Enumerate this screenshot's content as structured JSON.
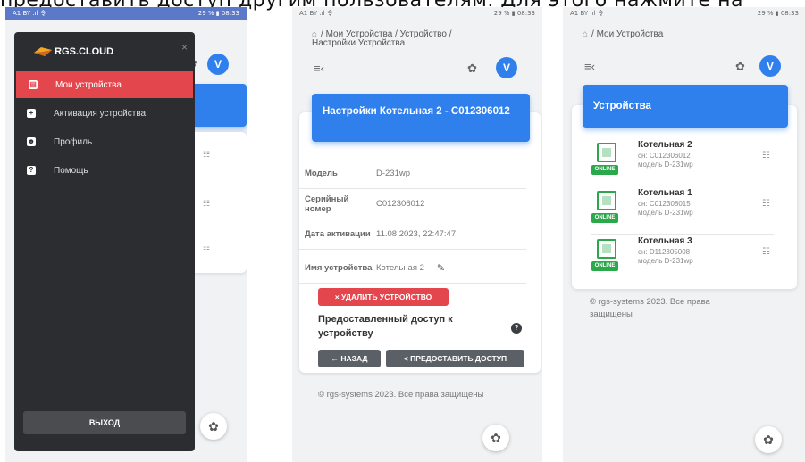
{
  "caption": "предоставить доступ другим пользователям. Для этого нажмите на",
  "status": {
    "left": "A1 BY .ıl 令 ",
    "right": "29 % ▮ 08:33"
  },
  "phone1": {
    "brand": "RGS.CLOUD",
    "menu": [
      {
        "label": "Мои устройства",
        "icon": "devices-icon"
      },
      {
        "label": "Активация устройства",
        "icon": "plus-icon"
      },
      {
        "label": "Профиль",
        "icon": "profile-icon"
      },
      {
        "label": "Помощь",
        "icon": "help-icon"
      }
    ],
    "logout": "ВЫХОД",
    "avatar": "V"
  },
  "phone2": {
    "breadcrumb": "/ Мои Устройства / Устройство /",
    "breadcrumb2": "Настройки Устройства",
    "avatar": "V",
    "title": "Настройки Котельная 2 - C012306012",
    "rows": [
      {
        "key": "Модель",
        "value": "D-231wp"
      },
      {
        "key": "Серийный номер",
        "value": "C012306012"
      },
      {
        "key": "Дата активации",
        "value": "11.08.2023, 22:47:47"
      },
      {
        "key": "Имя устройства",
        "value": "Котельная 2"
      }
    ],
    "delete_button": "× УДАЛИТЬ УСТРОЙСТВО",
    "access_heading": "Предоставленный доступ к устройству",
    "back_button": "← НАЗАД",
    "share_button": "< ПРЕДОСТАВИТЬ ДОСТУП",
    "footer": "© rgs-systems 2023. Все права защищены"
  },
  "phone3": {
    "breadcrumb": "/ Мои Устройства",
    "avatar": "V",
    "title": "Устройства",
    "devices": [
      {
        "name": "Котельная 2",
        "serial": "сн: C012306012",
        "model": "модель D-231wp",
        "status": "ONLINE"
      },
      {
        "name": "Котельная 1",
        "serial": "сн: C012308015",
        "model": "модель D-231wp",
        "status": "ONLINE"
      },
      {
        "name": "Котельная 3",
        "serial": "сн: D112305008",
        "model": "модель D-231wp",
        "status": "ONLINE"
      }
    ],
    "footer": "© rgs-systems 2023. Все права защищены"
  },
  "colors": {
    "accent": "#2f80ed",
    "danger": "#e4464d",
    "online": "#2aa84a",
    "drawer": "#2b2d30"
  }
}
